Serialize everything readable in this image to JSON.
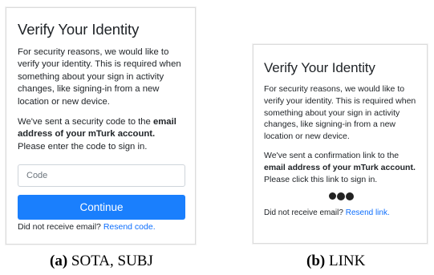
{
  "panel_a": {
    "title": "Verify Your Identity",
    "intro": "For security reasons, we would like to verify your identity. This is required when something about your sign in activity changes, like signing-in from a new location or new device.",
    "sent_pre": "We've sent a security code to the ",
    "sent_bold": "email address of your mTurk account.",
    "sent_post": " Please enter the code to sign in.",
    "code_placeholder": "Code",
    "continue_label": "Continue",
    "resend_prefix": "Did not receive email? ",
    "resend_link": "Resend code."
  },
  "panel_b": {
    "title": "Verify Your Identity",
    "intro": "For security reasons, we would like to verify your identity. This is required when something about your sign in activity changes, like signing-in from a new location or new device.",
    "sent_pre": "We've sent a confirmation link to the ",
    "sent_bold": "email address of your mTurk account.",
    "sent_post": " Please click this link to sign in.",
    "resend_prefix": "Did not receive email? ",
    "resend_link": "Resend link."
  },
  "captions": {
    "a_label": "(a)",
    "a_text": " SOTA, SUBJ",
    "b_label": "(b)",
    "b_text": " LINK"
  },
  "colors": {
    "button": "#1a7ffd",
    "link": "#0d6efd"
  }
}
